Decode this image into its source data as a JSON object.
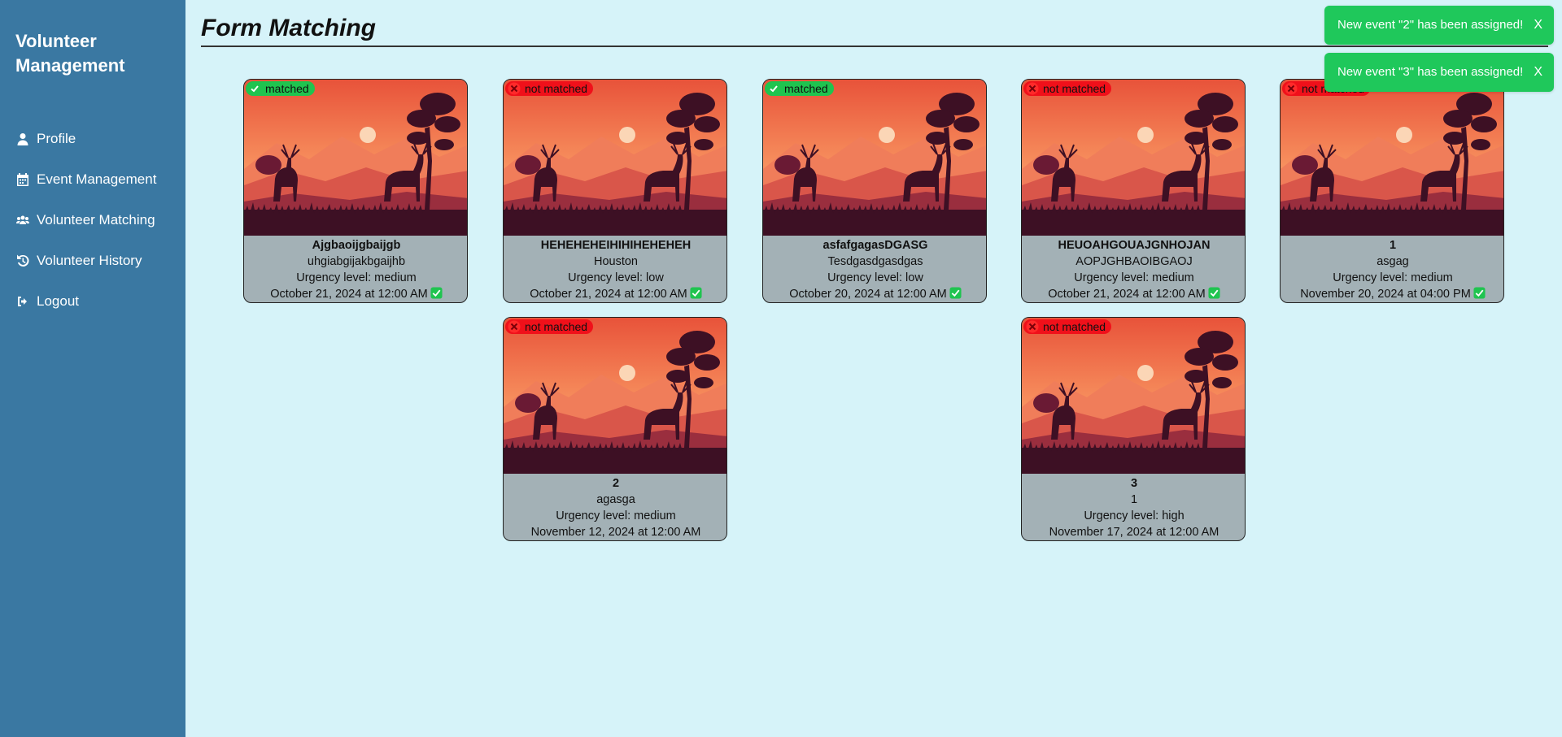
{
  "sidebar": {
    "brand": "Volunteer Management",
    "items": [
      {
        "label": "Profile",
        "icon": "user-icon"
      },
      {
        "label": "Event Management",
        "icon": "calendar-icon"
      },
      {
        "label": "Volunteer Matching",
        "icon": "users-icon"
      },
      {
        "label": "Volunteer History",
        "icon": "history-icon"
      },
      {
        "label": "Logout",
        "icon": "logout-icon"
      }
    ]
  },
  "page": {
    "title": "Form Matching"
  },
  "toasts": [
    {
      "message": "New event \"2\" has been assigned!",
      "close": "X"
    },
    {
      "message": "New event \"3\" has been assigned!",
      "close": "X"
    }
  ],
  "cards": [
    {
      "status": "matched",
      "name": "Ajgbaoijgbaijgb",
      "description": "uhgiabgijakbgaijhb",
      "urgency": "Urgency level: medium",
      "date": "October 21, 2024 at 12:00 AM",
      "checked": true
    },
    {
      "status": "not matched",
      "name": "HEHEHEHEIHIHIHEHEHEH",
      "description": "Houston",
      "urgency": "Urgency level: low",
      "date": "October 21, 2024 at 12:00 AM",
      "checked": true
    },
    {
      "status": "matched",
      "name": "asfafgagasDGASG",
      "description": "Tesdgasdgasdgas",
      "urgency": "Urgency level: low",
      "date": "October 20, 2024 at 12:00 AM",
      "checked": true
    },
    {
      "status": "not matched",
      "name": "HEUOAHGOUAJGNHOJAN",
      "description": "AOPJGHBAOIBGAOJ",
      "urgency": "Urgency level: medium",
      "date": "October 21, 2024 at 12:00 AM",
      "checked": true
    },
    {
      "status": "not matched",
      "name": "1",
      "description": "asgag",
      "urgency": "Urgency level: medium",
      "date": "November 20, 2024 at 04:00 PM",
      "checked": true
    },
    {
      "status": "not matched",
      "name": "2",
      "description": "agasga",
      "urgency": "Urgency level: medium",
      "date": "November 12, 2024 at 12:00 AM",
      "checked": false
    },
    {
      "status": "not matched",
      "name": "3",
      "description": "1",
      "urgency": "Urgency level: high",
      "date": "November 17, 2024 at 12:00 AM",
      "checked": false
    }
  ],
  "colors": {
    "sidebar": "#3a78a2",
    "background": "#d6f3f9",
    "matched": "#1fc44f",
    "not_matched": "#f0101a",
    "toast": "#1fc85b",
    "card_body": "#a3b1b6"
  }
}
